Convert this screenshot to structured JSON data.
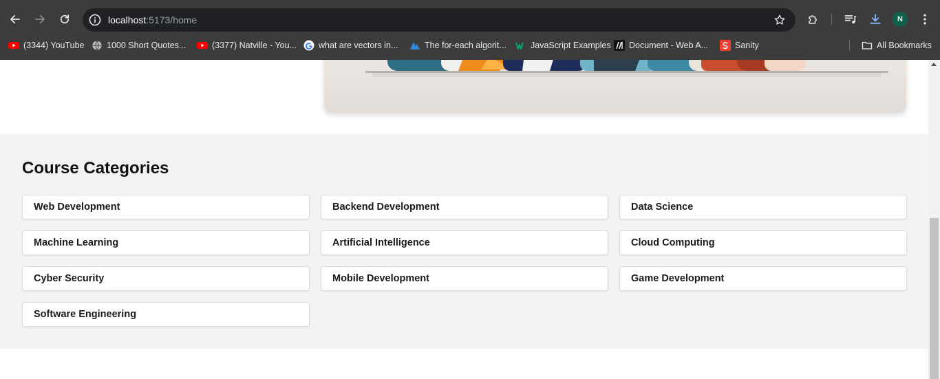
{
  "browser": {
    "url_host": "localhost",
    "url_path": ":5173/home",
    "avatar_initial": "N",
    "bookmarks": [
      {
        "label": "(3344) YouTube",
        "icon": "youtube-icon"
      },
      {
        "label": "1000 Short Quotes...",
        "icon": "globe-icon"
      },
      {
        "label": "(3377) Natville - You...",
        "icon": "youtube-icon"
      },
      {
        "label": "what are vectors in...",
        "icon": "google-icon"
      },
      {
        "label": "The for-each algorit...",
        "icon": "bookmark-site-icon"
      },
      {
        "label": "JavaScript Examples",
        "icon": "w3schools-icon"
      },
      {
        "label": "Document - Web A...",
        "icon": "mdn-icon"
      },
      {
        "label": "Sanity",
        "icon": "sanity-icon"
      }
    ],
    "all_bookmarks_label": "All Bookmarks"
  },
  "categories": {
    "title": "Course Categories",
    "items": [
      {
        "label": "Web Development"
      },
      {
        "label": "Backend Development"
      },
      {
        "label": "Data Science"
      },
      {
        "label": "Machine Learning"
      },
      {
        "label": "Artificial Intelligence"
      },
      {
        "label": "Cloud Computing"
      },
      {
        "label": "Cyber Security"
      },
      {
        "label": "Mobile Development"
      },
      {
        "label": "Game Development"
      },
      {
        "label": "Software Engineering"
      }
    ]
  },
  "colors": {
    "chrome_bg": "#3c3c3c",
    "omnibox_bg": "#202124",
    "section_bg": "#f2f3f5",
    "download_accent": "#8ab4f8",
    "avatar_bg": "#0f5f4a"
  }
}
